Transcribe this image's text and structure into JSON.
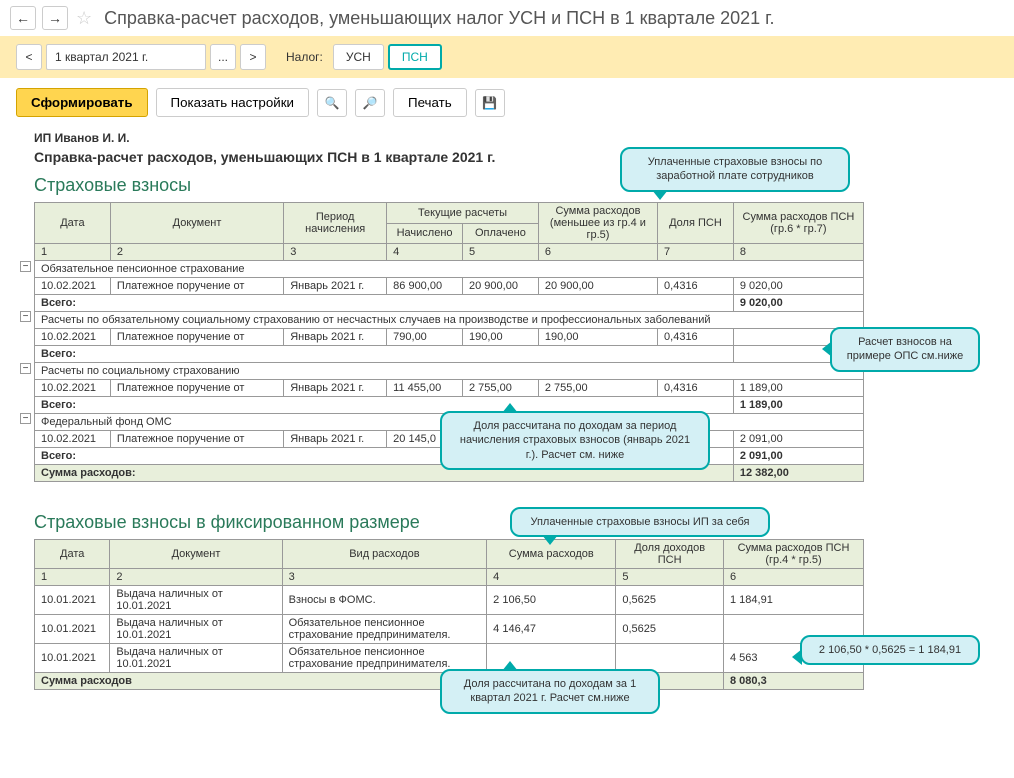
{
  "header": {
    "title": "Справка-расчет расходов, уменьшающих налог УСН и ПСН в 1 квартале 2021 г."
  },
  "period_bar": {
    "prev": "<",
    "next": ">",
    "dots": "...",
    "period": "1 квартал 2021 г.",
    "tax_label": "Налог:",
    "tax_usn": "УСН",
    "tax_psn": "ПСН"
  },
  "toolbar": {
    "generate": "Сформировать",
    "settings": "Показать настройки",
    "print": "Печать"
  },
  "report": {
    "org": "ИП Иванов И. И.",
    "title": "Справка-расчет расходов, уменьшающих ПСН в 1 квартале 2021 г.",
    "section1": {
      "title": "Страховые взносы",
      "cols": {
        "c1": "Дата",
        "c2": "Документ",
        "c3": "Период начисления",
        "c4g": "Текущие расчеты",
        "c4": "Начислено",
        "c5": "Оплачено",
        "c6": "Сумма расходов (меньшее из гр.4 и гр.5)",
        "c7": "Доля ПСН",
        "c8": "Сумма расходов ПСН (гр.6 * гр.7)"
      },
      "nums": {
        "n1": "1",
        "n2": "2",
        "n3": "3",
        "n4": "4",
        "n5": "5",
        "n6": "6",
        "n7": "7",
        "n8": "8"
      },
      "g1": {
        "name": "Обязательное пенсионное страхование",
        "date": "10.02.2021",
        "doc": "Платежное поручение от",
        "period": "Январь 2021 г.",
        "acc": "86 900,00",
        "paid": "20 900,00",
        "sum": "20 900,00",
        "share": "0,4316",
        "psn": "9 020,00",
        "total_label": "Всего:",
        "total": "9 020,00"
      },
      "g2": {
        "name": "Расчеты по обязательному социальному страхованию от несчастных случаев на производстве и профессиональных заболеваний",
        "date": "10.02.2021",
        "doc": "Платежное поручение от",
        "period": "Январь 2021 г.",
        "acc": "790,00",
        "paid": "190,00",
        "sum": "190,00",
        "share": "0,4316",
        "psn": "",
        "total_label": "Всего:",
        "total": ""
      },
      "g3": {
        "name": "Расчеты по социальному страхованию",
        "date": "10.02.2021",
        "doc": "Платежное поручение от",
        "period": "Январь 2021 г.",
        "acc": "11 455,00",
        "paid": "2 755,00",
        "sum": "2 755,00",
        "share": "0,4316",
        "psn": "1 189,00",
        "total_label": "Всего:",
        "total": "1 189,00"
      },
      "g4": {
        "name": "Федеральный фонд ОМС",
        "date": "10.02.2021",
        "doc": "Платежное поручение от",
        "period": "Январь 2021 г.",
        "acc": "20 145,0",
        "paid": "",
        "sum": "",
        "share": "",
        "psn": "2 091,00",
        "total_label": "Всего:",
        "total": "2 091,00"
      },
      "sum_label": "Сумма расходов:",
      "sum_total": "12 382,00"
    },
    "section2": {
      "title": "Страховые взносы в фиксированном размере",
      "cols": {
        "c1": "Дата",
        "c2": "Документ",
        "c3": "Вид расходов",
        "c4": "Сумма расходов",
        "c5": "Доля доходов ПСН",
        "c6": "Сумма расходов ПСН (гр.4 * гр.5)"
      },
      "nums": {
        "n1": "1",
        "n2": "2",
        "n3": "3",
        "n4": "4",
        "n5": "5",
        "n6": "6"
      },
      "r1": {
        "date": "10.01.2021",
        "doc": "Выдача наличных  от 10.01.2021",
        "type": "Взносы в ФОМС.",
        "sum": "2 106,50",
        "share": "0,5625",
        "psn": "1 184,91"
      },
      "r2": {
        "date": "10.01.2021",
        "doc": "Выдача наличных  от 10.01.2021",
        "type": "Обязательное пенсионное страхование предпринимателя.",
        "sum": "4 146,47",
        "share": "0,5625",
        "psn": ""
      },
      "r3": {
        "date": "10.01.2021",
        "doc": "Выдача наличных  от 10.01.2021",
        "type": "Обязательное пенсионное страхование предпринимателя.",
        "sum": "",
        "share": "",
        "psn": "4 563"
      },
      "sum_label": "Сумма расходов",
      "sum_total": "8 080,3"
    }
  },
  "callouts": {
    "c1": "Уплаченные страховые взносы по заработной плате сотрудников",
    "c2": "Расчет взносов на примере ОПС см.ниже",
    "c3": "Доля рассчитана по доходам за период начисления страховых взносов (январь 2021 г.). Расчет см. ниже",
    "c4": "Уплаченные страховые взносы ИП за себя",
    "c5": "2 106,50 * 0,5625 = 1 184,91",
    "c6": "Доля рассчитана по доходам за 1 квартал 2021 г. Расчет см.ниже"
  }
}
